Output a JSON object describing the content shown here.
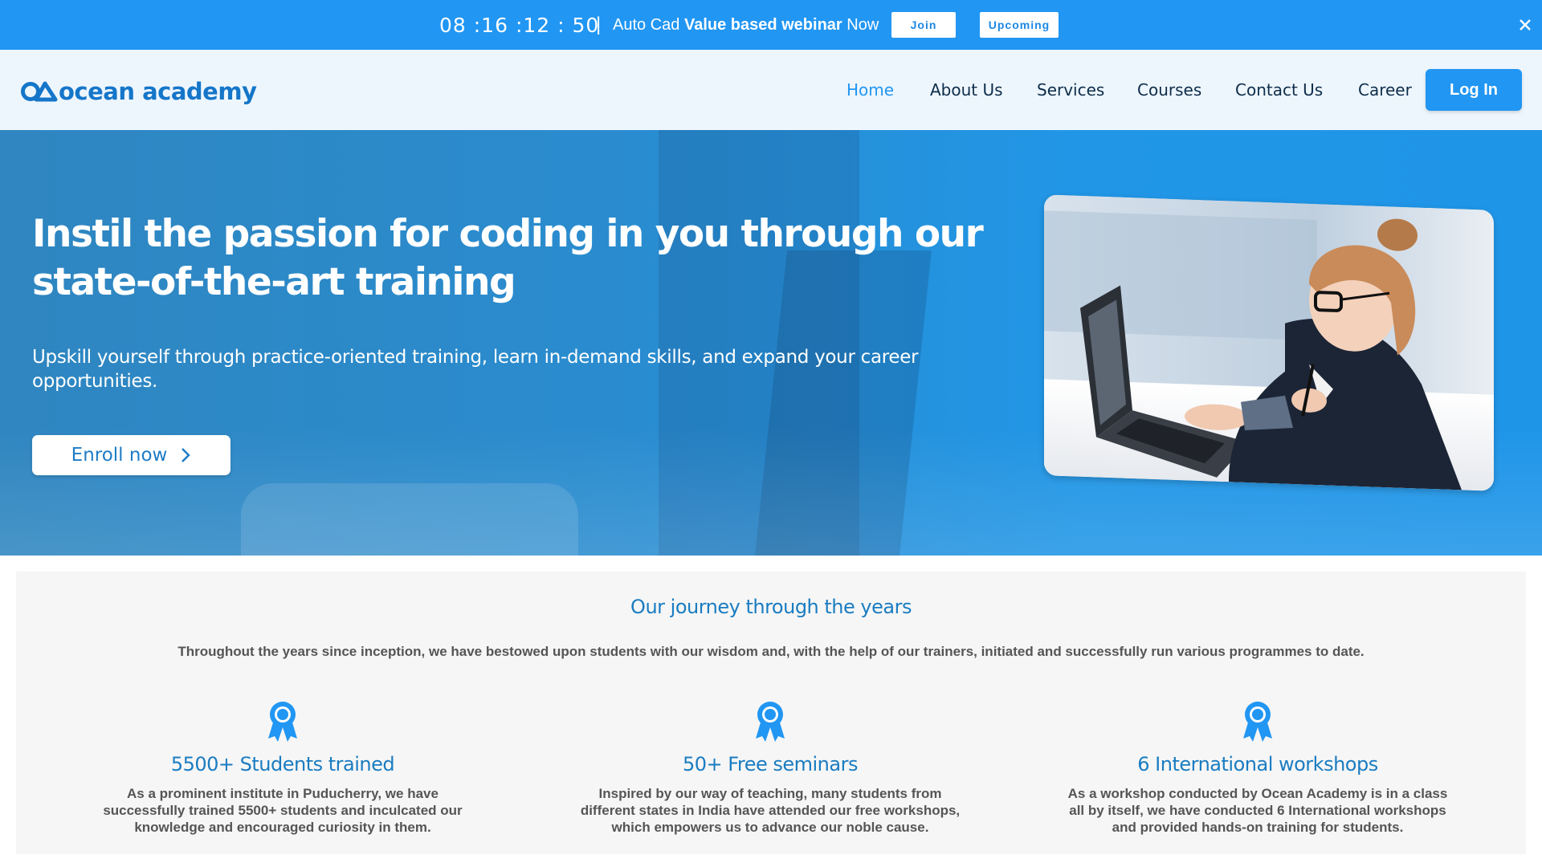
{
  "topbar": {
    "countdown": "08 :16 :12 : 50",
    "separator": "|",
    "promo_prefix": "Auto Cad ",
    "promo_bold": "Value based webinar",
    "promo_suffix": " Now",
    "join_label": "Join",
    "upcoming_label": "Upcoming",
    "close_icon": "close-icon"
  },
  "nav": {
    "logo_text": "ocean academy",
    "logo_icon": "ocean-academy-logo-icon",
    "items": [
      {
        "label": "Home",
        "active": true
      },
      {
        "label": "About Us",
        "active": false
      },
      {
        "label": "Services",
        "active": false
      },
      {
        "label": "Courses",
        "active": false
      },
      {
        "label": "Contact Us",
        "active": false
      },
      {
        "label": "Career",
        "active": false
      }
    ],
    "login_label": "Log In"
  },
  "hero": {
    "title": "Instil the passion for coding in you through our state-of-the-art training",
    "subtitle": "Upskill yourself through practice-oriented training, learn in-demand skills, and expand your career opportunities.",
    "enroll_label": "Enroll now",
    "enroll_icon": "chevron-right-icon"
  },
  "journey": {
    "title": "Our journey through the years",
    "intro": "Throughout the years since inception, we have bestowed upon students with our wisdom and, with the help of our trainers, initiated and successfully run various programmes to date.",
    "cards": [
      {
        "icon": "award-ribbon-icon",
        "title": "5500+ Students trained",
        "text": "As a prominent institute in Puducherry, we have successfully trained 5500+ students and inculcated our knowledge and encouraged curiosity in them."
      },
      {
        "icon": "award-ribbon-icon",
        "title": "50+ Free seminars",
        "text": "Inspired by our way of teaching, many students from different states in India have attended our free workshops, which empowers us to advance our noble cause."
      },
      {
        "icon": "award-ribbon-icon",
        "title": "6 International workshops",
        "text": "As a workshop conducted by Ocean Academy is in a class all by itself, we have conducted 6 International workshops and provided hands-on training for students."
      }
    ]
  },
  "colors": {
    "brand_blue": "#2196f3",
    "heading_blue": "#1a7cc1",
    "nav_bg": "#eef6fd"
  }
}
